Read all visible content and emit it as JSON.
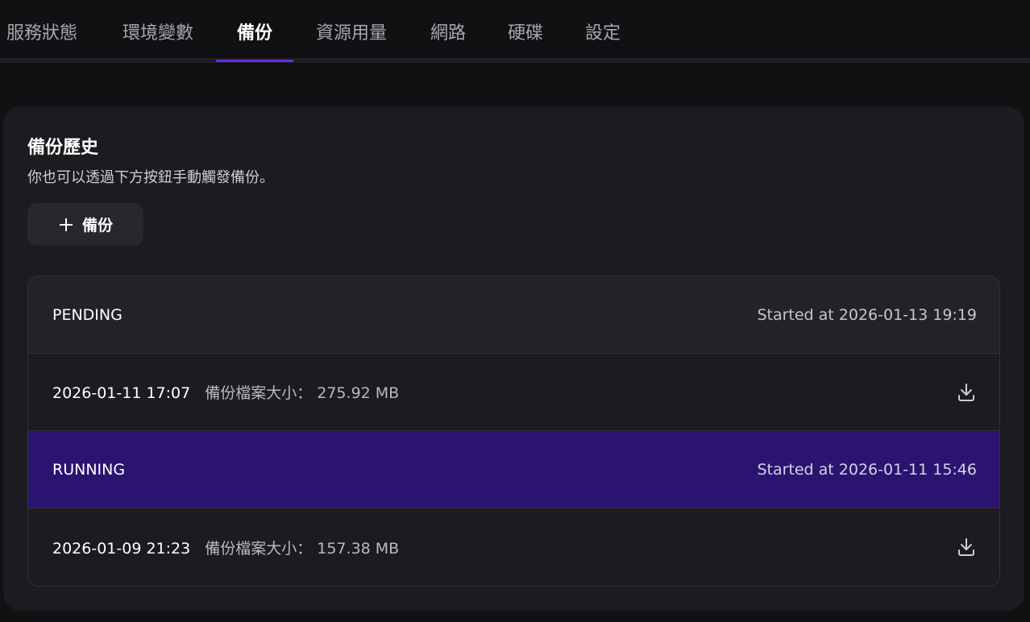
{
  "tabs": [
    {
      "label": "服務狀態",
      "active": false
    },
    {
      "label": "環境變數",
      "active": false
    },
    {
      "label": "備份",
      "active": true
    },
    {
      "label": "資源用量",
      "active": false
    },
    {
      "label": "網路",
      "active": false
    },
    {
      "label": "硬碟",
      "active": false
    },
    {
      "label": "設定",
      "active": false
    }
  ],
  "backup": {
    "title": "備份歷史",
    "description": "你也可以透過下方按鈕手動觸發備份。",
    "add_button": {
      "label": "備份",
      "icon": "plus-icon"
    },
    "rows": [
      {
        "type": "status",
        "status": "PENDING",
        "started": "Started at 2026-01-13 19:19"
      },
      {
        "type": "file",
        "date": "2026-01-11 17:07",
        "size": "備份檔案大小： 275.92 MB",
        "icon": "download-icon"
      },
      {
        "type": "status",
        "status": "RUNNING",
        "started": "Started at 2026-01-11 15:46"
      },
      {
        "type": "file",
        "date": "2026-01-09 21:23",
        "size": "備份檔案大小： 157.38 MB",
        "icon": "download-icon"
      }
    ]
  },
  "colors": {
    "accent": "#6d28f0",
    "running_row": "#2b1470",
    "background": "#111013",
    "card": "#1c1b1f"
  }
}
